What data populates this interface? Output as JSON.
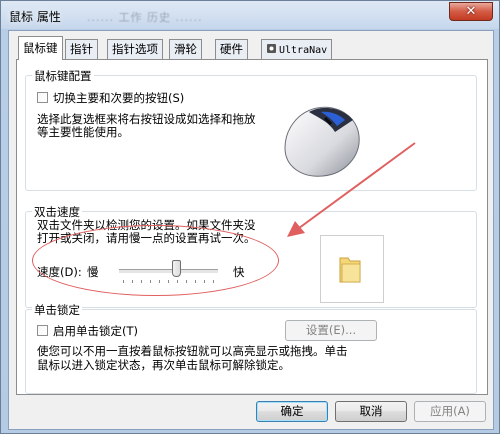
{
  "window": {
    "title": "鼠标 属性",
    "background_caption": "...... 工作  历史 ......",
    "close_glyph": "✕"
  },
  "tabs": [
    {
      "label": "鼠标键",
      "active": true
    },
    {
      "label": "指针"
    },
    {
      "label": "指针选项"
    },
    {
      "label": "滑轮"
    },
    {
      "label": "硬件"
    },
    {
      "label": "UltraNav"
    }
  ],
  "buttons_config": {
    "title": "鼠标键配置",
    "swap_label": "切换主要和次要的按钮(S)",
    "swap_checked": false,
    "description_line1": "选择此复选框来将右按钮设成如选择和拖放",
    "description_line2": "等主要性能使用。"
  },
  "double_click": {
    "title": "双击速度",
    "description_line1": "双击文件夹以检测您的设置。如果文件夹没",
    "description_line2": "打开或关闭，请用慢一点的设置再试一次。",
    "speed_label": "速度(D):",
    "slow_label": "慢",
    "fast_label": "快",
    "speed_value": 0.59
  },
  "click_lock": {
    "title": "单击锁定",
    "enable_label": "启用单击锁定(T)",
    "enable_checked": false,
    "settings_button": "设置(E)...",
    "description_line1": "使您可以不用一直按着鼠标按钮就可以高亮显示或拖拽。单击",
    "description_line2": "鼠标以进入锁定状态，再次单击鼠标可解除锁定。"
  },
  "footer": {
    "ok": "确定",
    "cancel": "取消",
    "apply": "应用(A)"
  },
  "colors": {
    "annotation_red": "#e06060",
    "default_button_border": "#3c7fb1"
  }
}
